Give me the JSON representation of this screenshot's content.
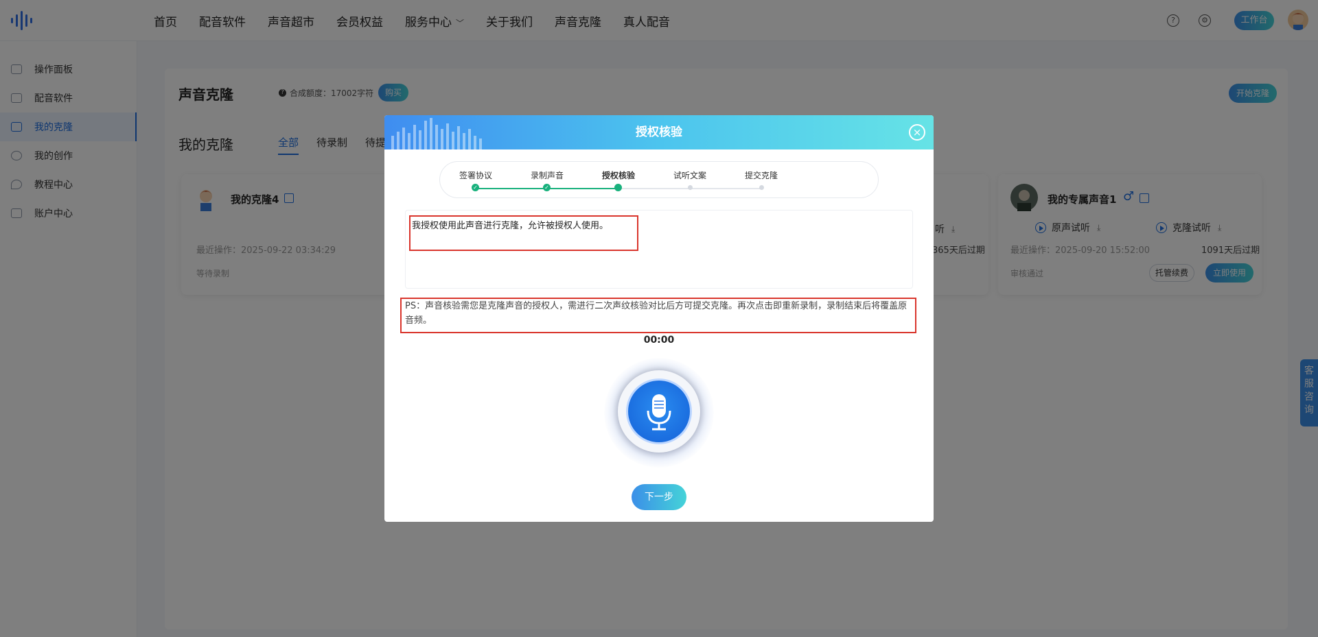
{
  "nav": {
    "items": [
      "首页",
      "配音软件",
      "声音超市",
      "会员权益",
      "服务中心",
      "关于我们",
      "声音克隆",
      "真人配音"
    ]
  },
  "topbar": {
    "workbench_label": "工作台"
  },
  "sidebar": {
    "items": [
      {
        "label": "操作面板",
        "active": false
      },
      {
        "label": "配音软件",
        "active": false
      },
      {
        "label": "我的克隆",
        "active": true
      },
      {
        "label": "我的创作",
        "active": false
      },
      {
        "label": "教程中心",
        "active": false
      },
      {
        "label": "账户中心",
        "active": false
      }
    ]
  },
  "page": {
    "title": "声音克隆",
    "quota": "合成额度：17002字符",
    "buy_label": "购买",
    "start_clone_label": "开始克隆",
    "section_title": "我的克隆",
    "tabs": [
      "全部",
      "待录制",
      "待提"
    ]
  },
  "cards": {
    "left": {
      "name": "我的克隆4",
      "last_op": "最近操作：2025-09-22 03:34:29",
      "status": "等待录制"
    },
    "middle_partial": {
      "play_suffix": "听",
      "expiry": "365天后过期"
    },
    "right": {
      "name": "我的专属声音1",
      "gender_icon": "♂",
      "orig_listen": "原声试听",
      "clone_listen": "克隆试听",
      "last_op": "最近操作：2025-09-20 15:52:00",
      "expiry": "1091天后过期",
      "status": "审核通过",
      "host_fee": "托管续费",
      "use_now": "立即使用"
    }
  },
  "kefu": "客服咨询",
  "modal": {
    "title": "授权核验",
    "steps": [
      "签署协议",
      "录制声音",
      "授权核验",
      "试听文案",
      "提交克隆"
    ],
    "current_step": 2,
    "auth_text": "我授权使用此声音进行克隆，允许被授权人使用。",
    "ps_text": "PS：声音核验需您是克隆声音的授权人，需进行二次声纹核验对比后方可提交克隆。再次点击即重新录制，录制结束后将覆盖原音频。",
    "timer": "00:00",
    "next_label": "下一步"
  },
  "colors": {
    "accent": "#1f6fe0",
    "gradient_start": "#3b8fe8",
    "gradient_end": "#45d3d8",
    "success": "#19b17d",
    "highlight_red": "#d9342b"
  },
  "icons": {
    "logo": "sound-wave-logo",
    "help": "question-circle-icon",
    "settings": "gear-icon",
    "close": "close-circle-icon",
    "mic": "microphone-icon",
    "check": "check-icon",
    "edit": "edit-icon",
    "play": "play-circle-icon",
    "download": "download-icon"
  }
}
